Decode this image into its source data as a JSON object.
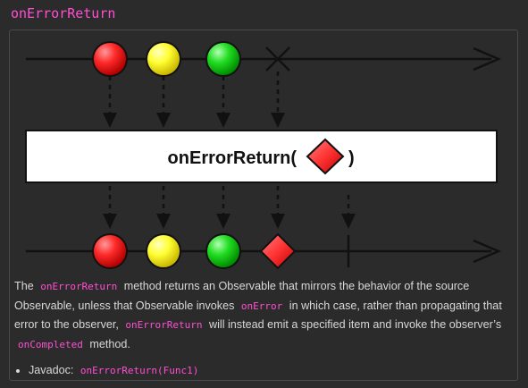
{
  "page": {
    "title": "onErrorReturn"
  },
  "diagram": {
    "operator_label": "onErrorReturn(",
    "operator_close": ")",
    "colors": {
      "red": "#ff2a2a",
      "yellow": "#ffff33",
      "green": "#22dd22",
      "diamond": "#ff3333",
      "box_fill": "#ffffff",
      "line": "#111111"
    },
    "icons": [
      "red-marble-icon",
      "yellow-marble-icon",
      "green-marble-icon",
      "error-x-icon",
      "diamond-item-icon",
      "completion-bar-icon",
      "arrowhead-icon"
    ]
  },
  "description": {
    "p1": "The ",
    "c1": "onErrorReturn",
    "p2": " method returns an Observable that mirrors the behavior of the source Observable, unless that Observable invokes ",
    "c2": "onError",
    "p3": " in which case, rather than propagating that error to the observer, ",
    "c3": "onErrorReturn",
    "p4": " will instead emit a specified item and invoke the observer’s ",
    "c4": "onCompleted",
    "p5": " method."
  },
  "links": {
    "javadoc_label": "Javadoc: ",
    "javadoc_code": "onErrorReturn(Func1)"
  }
}
